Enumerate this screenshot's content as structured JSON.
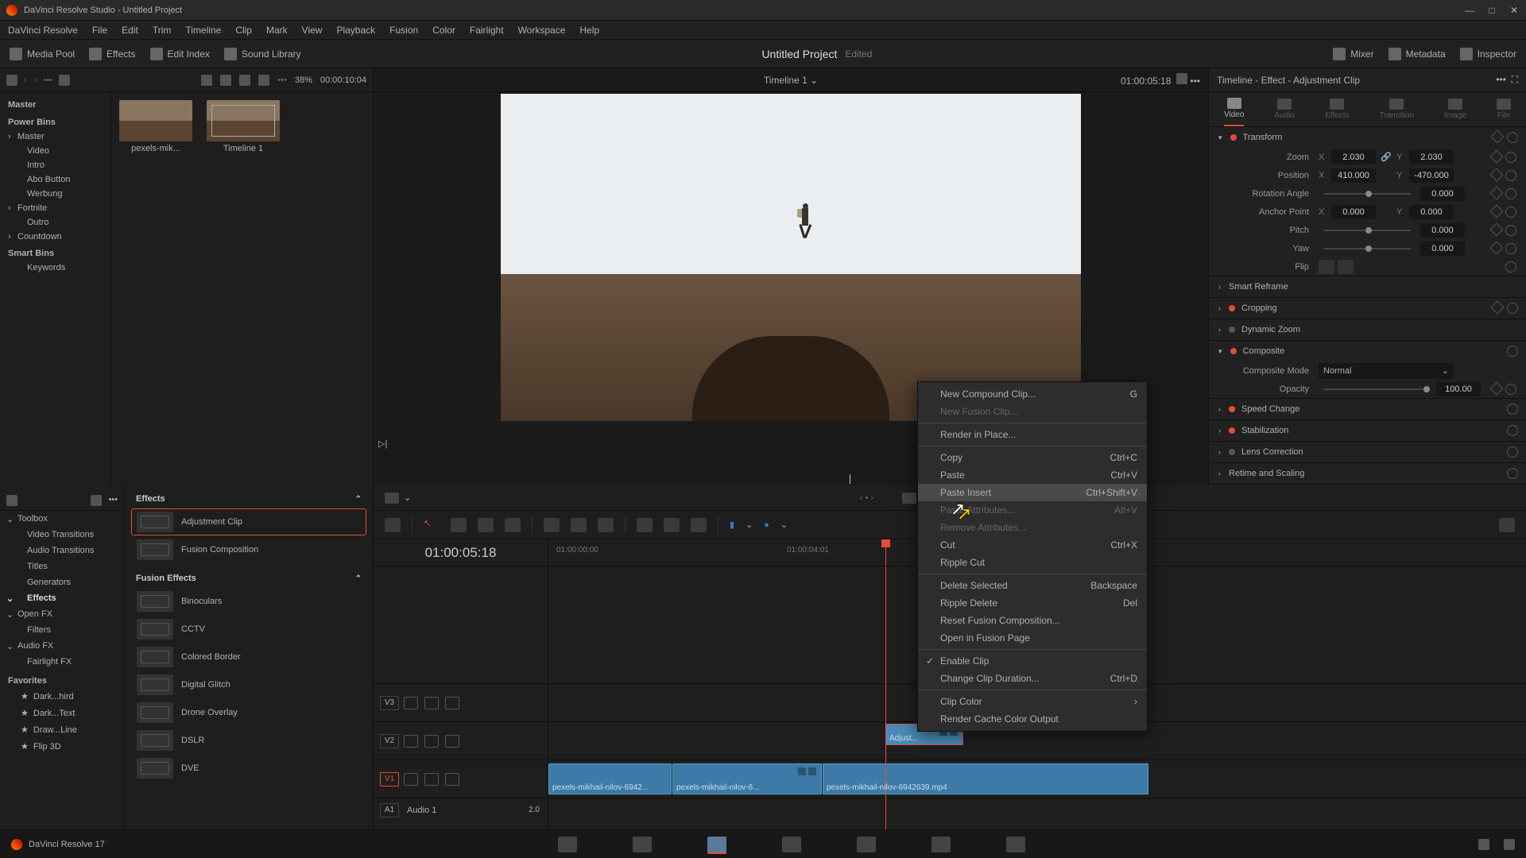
{
  "titlebar": {
    "title": "DaVinci Resolve Studio - Untitled Project"
  },
  "menu": [
    "DaVinci Resolve",
    "File",
    "Edit",
    "Trim",
    "Timeline",
    "Clip",
    "Mark",
    "View",
    "Playback",
    "Fusion",
    "Color",
    "Fairlight",
    "Workspace",
    "Help"
  ],
  "ws": {
    "left": [
      {
        "icon": "media-pool-icon",
        "label": "Media Pool"
      },
      {
        "icon": "effects-icon",
        "label": "Effects"
      },
      {
        "icon": "edit-index-icon",
        "label": "Edit Index"
      },
      {
        "icon": "sound-lib-icon",
        "label": "Sound Library"
      }
    ],
    "title": "Untitled Project",
    "edited": "Edited",
    "right": [
      {
        "icon": "mixer-icon",
        "label": "Mixer"
      },
      {
        "icon": "metadata-icon",
        "label": "Metadata"
      },
      {
        "icon": "inspector-icon",
        "label": "Inspector"
      }
    ]
  },
  "pool": {
    "zoom": "38%",
    "tc": "00:00:10:04",
    "tree": {
      "master": "Master",
      "powerbins": "Power Bins",
      "items": [
        "Master",
        "Video",
        "Intro",
        "Abo Button",
        "Werbung",
        "Fortnite",
        "Outro",
        "Countdown"
      ],
      "smartbins": "Smart Bins",
      "keywords": "Keywords"
    },
    "thumbs": [
      {
        "name": "pexels-mik..."
      },
      {
        "name": "Timeline 1"
      }
    ]
  },
  "viewer": {
    "title": "Timeline 1",
    "tc": "01:00:05:18"
  },
  "inspector": {
    "title": "Timeline - Effect - Adjustment Clip",
    "tabs": [
      "Video",
      "Audio",
      "Effects",
      "Transition",
      "Image",
      "File"
    ],
    "transform": {
      "h": "Transform",
      "zoom_l": "Zoom",
      "zoom_x": "2.030",
      "zoom_y": "2.030",
      "pos_l": "Position",
      "pos_x": "410.000",
      "pos_y": "-470.000",
      "rot_l": "Rotation Angle",
      "rot": "0.000",
      "anc_l": "Anchor Point",
      "anc_x": "0.000",
      "anc_y": "0.000",
      "pitch_l": "Pitch",
      "pitch": "0.000",
      "yaw_l": "Yaw",
      "yaw": "0.000",
      "flip_l": "Flip"
    },
    "sections": {
      "smart": "Smart Reframe",
      "crop": "Cropping",
      "dyn": "Dynamic Zoom",
      "comp": "Composite",
      "comp_mode_l": "Composite Mode",
      "comp_mode": "Normal",
      "op_l": "Opacity",
      "op": "100.00",
      "speed": "Speed Change",
      "stab": "Stabilization",
      "lens": "Lens Correction",
      "retime": "Retime and Scaling"
    }
  },
  "fx": {
    "tree": {
      "toolbox": "Toolbox",
      "cats": [
        "Video Transitions",
        "Audio Transitions",
        "Titles",
        "Generators"
      ],
      "effects": "Effects",
      "openfx": "Open FX",
      "filters": "Filters",
      "audiofx": "Audio FX",
      "fairlight": "Fairlight FX",
      "favorites": "Favorites",
      "favs": [
        "Dark...hird",
        "Dark...Text",
        "Draw...Line",
        "Flip 3D"
      ]
    },
    "list": {
      "g1": "Effects",
      "items1": [
        {
          "n": "Adjustment Clip",
          "sel": true
        },
        {
          "n": "Fusion Composition"
        }
      ],
      "g2": "Fusion Effects",
      "items2": [
        {
          "n": "Binoculars"
        },
        {
          "n": "CCTV"
        },
        {
          "n": "Colored Border"
        },
        {
          "n": "Digital Glitch"
        },
        {
          "n": "Drone Overlay"
        },
        {
          "n": "DSLR"
        },
        {
          "n": "DVE"
        }
      ]
    }
  },
  "timeline": {
    "tc": "01:00:05:18",
    "ticks": [
      "01:00:00:00",
      "01:00:04:01"
    ],
    "tracks": {
      "v3": "V3",
      "v2": "V2",
      "v1": "V1",
      "a1": "A1",
      "a1l": "Audio 1",
      "a1v": "2.0"
    },
    "clips": {
      "adj": "Adjust...",
      "c1": "pexels-mikhail-nilov-6942...",
      "c2": "pexels-mikhail-nilov-6...",
      "c3": "pexels-mikhail-nilov-6942639.mp4"
    }
  },
  "ctx": [
    {
      "t": "New Compound Clip...",
      "s": "G"
    },
    {
      "t": "New Fusion Clip...",
      "dis": true
    },
    {
      "sep": true
    },
    {
      "t": "Render in Place..."
    },
    {
      "sep": true
    },
    {
      "t": "Copy",
      "s": "Ctrl+C"
    },
    {
      "t": "Paste",
      "s": "Ctrl+V"
    },
    {
      "t": "Paste Insert",
      "s": "Ctrl+Shift+V",
      "hl": true
    },
    {
      "t": "Paste Attributes...",
      "s": "Alt+V",
      "dis": true
    },
    {
      "t": "Remove Attributes...",
      "dis": true
    },
    {
      "t": "Cut",
      "s": "Ctrl+X"
    },
    {
      "t": "Ripple Cut"
    },
    {
      "sep": true
    },
    {
      "t": "Delete Selected",
      "s": "Backspace"
    },
    {
      "t": "Ripple Delete",
      "s": "Del"
    },
    {
      "t": "Reset Fusion Composition..."
    },
    {
      "t": "Open in Fusion Page"
    },
    {
      "sep": true
    },
    {
      "t": "Enable Clip",
      "chk": true
    },
    {
      "t": "Change Clip Duration...",
      "s": "Ctrl+D"
    },
    {
      "sep": true
    },
    {
      "t": "Clip Color",
      "sub": true
    },
    {
      "t": "Render Cache Color Output"
    }
  ],
  "footer": {
    "ver": "DaVinci Resolve 17"
  }
}
